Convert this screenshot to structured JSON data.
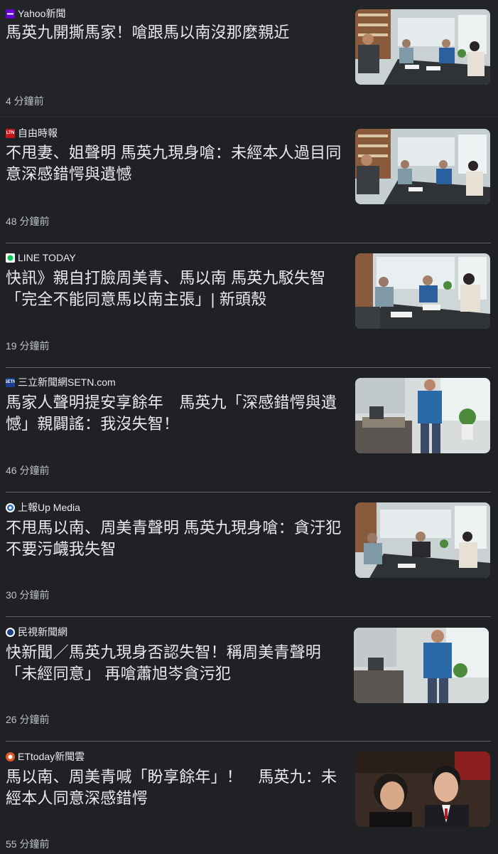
{
  "articles": [
    {
      "source": "Yahoo新聞",
      "favicon": "yahoo-icon",
      "favicon_color": "#6001d2",
      "headline": "馬英九開撕馬家！嗆跟馬以南沒那麼親近",
      "time": "4 分鐘前",
      "thumbnail": "meeting-room-photo"
    },
    {
      "source": "自由時報",
      "favicon": "ltn-icon",
      "favicon_color": "#c8161d",
      "headline": "不甩妻、姐聲明 馬英九現身嗆：未經本人過目同意深感錯愕與遺憾",
      "time": "48 分鐘前",
      "thumbnail": "meeting-room-photo"
    },
    {
      "source": "LINE TODAY",
      "favicon": "line-today-icon",
      "favicon_color": "#ffffff",
      "headline": "快訊》親自打臉周美青、馬以南 馬英九駁失智「完全不能同意馬以南主張」| 新頭殼",
      "time": "19 分鐘前",
      "thumbnail": "meeting-room-photo"
    },
    {
      "source": "三立新聞網SETN.com",
      "favicon": "setn-icon",
      "favicon_color": "#1a3f8f",
      "headline": "馬家人聲明提安享餘年　馬英九「深感錯愕與遺憾」親闢謠：我沒失智！",
      "time": "46 分鐘前",
      "thumbnail": "standing-man-photo"
    },
    {
      "source": "上報Up Media",
      "favicon": "upmedia-icon",
      "favicon_color": "#2b6cb0",
      "headline": "不甩馬以南、周美青聲明 馬英九現身嗆：貪汙犯不要污衊我失智",
      "time": "30 分鐘前",
      "thumbnail": "meeting-room-photo"
    },
    {
      "source": "民視新聞網",
      "favicon": "ftv-icon",
      "favicon_color": "#1d3f8a",
      "headline": "快新聞／馬英九現身否認失智！稱周美青聲明「未經同意」 再嗆蕭旭岑貪污犯",
      "time": "26 分鐘前",
      "thumbnail": "standing-man-photo"
    },
    {
      "source": "ETtoday新聞雲",
      "favicon": "ettoday-icon",
      "favicon_color": "#e05a2b",
      "headline": "馬以南、周美青喊「盼享餘年」！　馬英九：未經本人同意深感錯愕",
      "time": "55 分鐘前",
      "thumbnail": "couple-smiling-photo"
    }
  ]
}
